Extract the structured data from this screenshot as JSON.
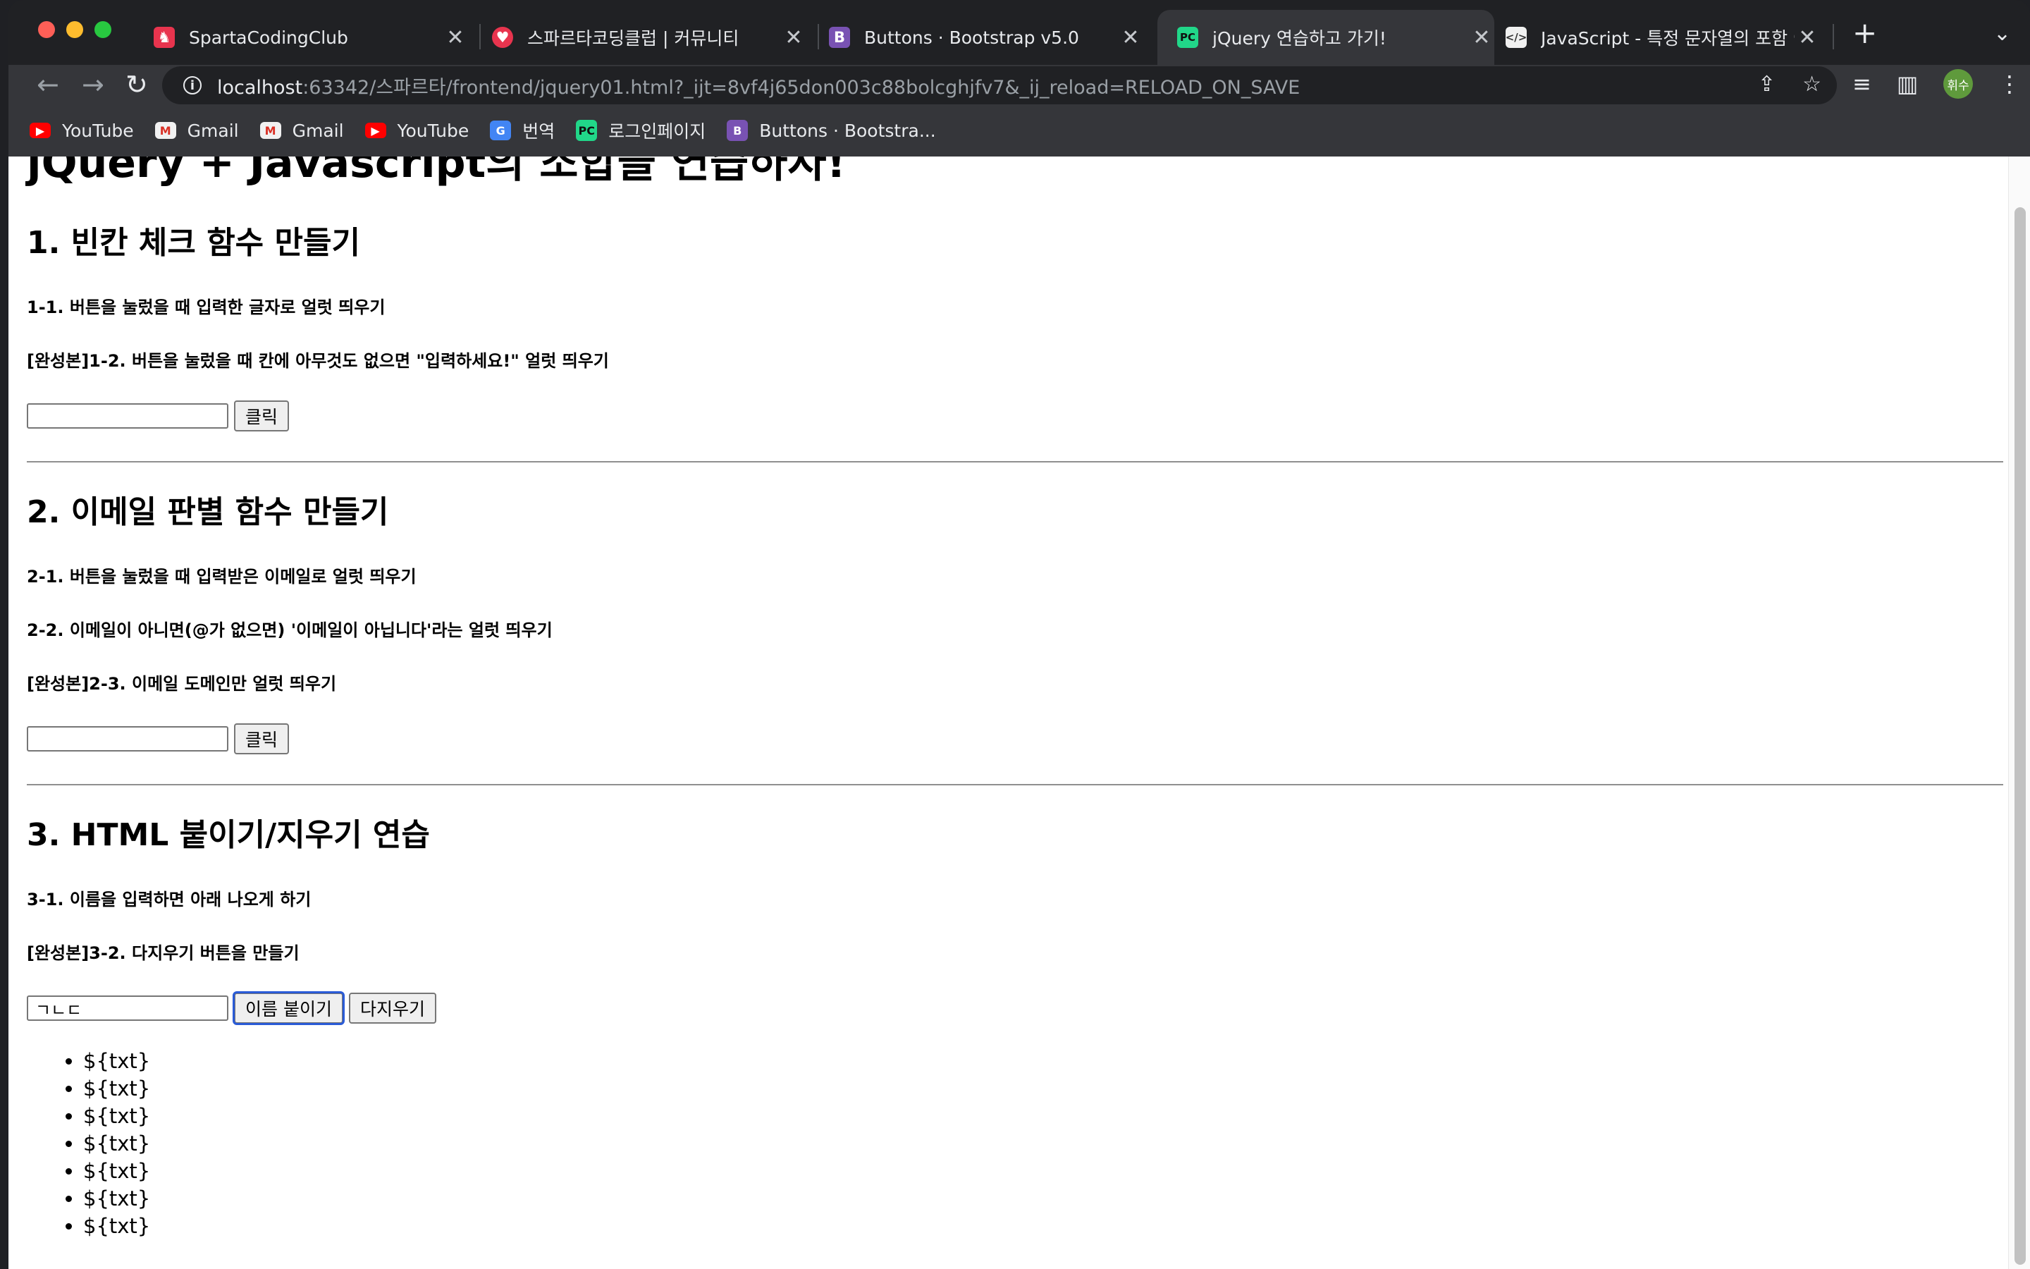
{
  "browser": {
    "tabs": [
      {
        "title": "SpartaCodingClub",
        "favicon": "sparta-icon",
        "active": false
      },
      {
        "title": "스파르타코딩클럽 | 커뮤니티",
        "favicon": "heart-code-icon",
        "active": false
      },
      {
        "title": "Buttons · Bootstrap v5.0",
        "favicon": "bootstrap-icon",
        "active": false
      },
      {
        "title": "jQuery 연습하고 가기!",
        "favicon": "pycharm-icon",
        "active": true
      },
      {
        "title": "JavaScript - 특정 문자열의 포함 여",
        "favicon": "code-icon",
        "active": false
      }
    ],
    "url_host": "localhost",
    "url_rest": ":63342/스파르타/frontend/jquery01.html?_ijt=8vf4j65don003c88bolcghjfv7&_ij_reload=RELOAD_ON_SAVE",
    "profile_label": "휘수",
    "bookmarks": [
      {
        "label": "YouTube",
        "icon": "youtube-icon"
      },
      {
        "label": "Gmail",
        "icon": "gmail-icon"
      },
      {
        "label": "Gmail",
        "icon": "gmail-icon"
      },
      {
        "label": "YouTube",
        "icon": "youtube-icon"
      },
      {
        "label": "번역",
        "icon": "translate-icon"
      },
      {
        "label": "로그인페이지",
        "icon": "pycharm-icon"
      },
      {
        "label": "Buttons · Bootstra...",
        "icon": "bootstrap-icon"
      }
    ]
  },
  "page": {
    "title": "jQuery + Javascript의 조합을 연습하자!",
    "section1": {
      "heading": "1. 빈칸 체크 함수 만들기",
      "items": [
        "1-1. 버튼을 눌렀을 때 입력한 글자로 얼럿 띄우기",
        "[완성본]1-2. 버튼을 눌렀을 때 칸에 아무것도 없으면 \"입력하세요!\" 얼럿 띄우기"
      ],
      "input_value": "",
      "button_label": "클릭"
    },
    "section2": {
      "heading": "2. 이메일 판별 함수 만들기",
      "items": [
        "2-1. 버튼을 눌렀을 때 입력받은 이메일로 얼럿 띄우기",
        "2-2. 이메일이 아니면(@가 없으면) '이메일이 아닙니다'라는 얼럿 띄우기",
        "[완성본]2-3. 이메일 도메인만 얼럿 띄우기"
      ],
      "input_value": "",
      "button_label": "클릭"
    },
    "section3": {
      "heading": "3. HTML 붙이기/지우기 연습",
      "items": [
        "3-1. 이름을 입력하면 아래 나오게 하기",
        "[완성본]3-2. 다지우기 버튼을 만들기"
      ],
      "input_value": "ㄱㄴㄷ",
      "append_button_label": "이름 붙이기",
      "clear_button_label": "다지우기",
      "names": [
        "${txt}",
        "${txt}",
        "${txt}",
        "${txt}",
        "${txt}",
        "${txt}",
        "${txt}"
      ]
    }
  }
}
